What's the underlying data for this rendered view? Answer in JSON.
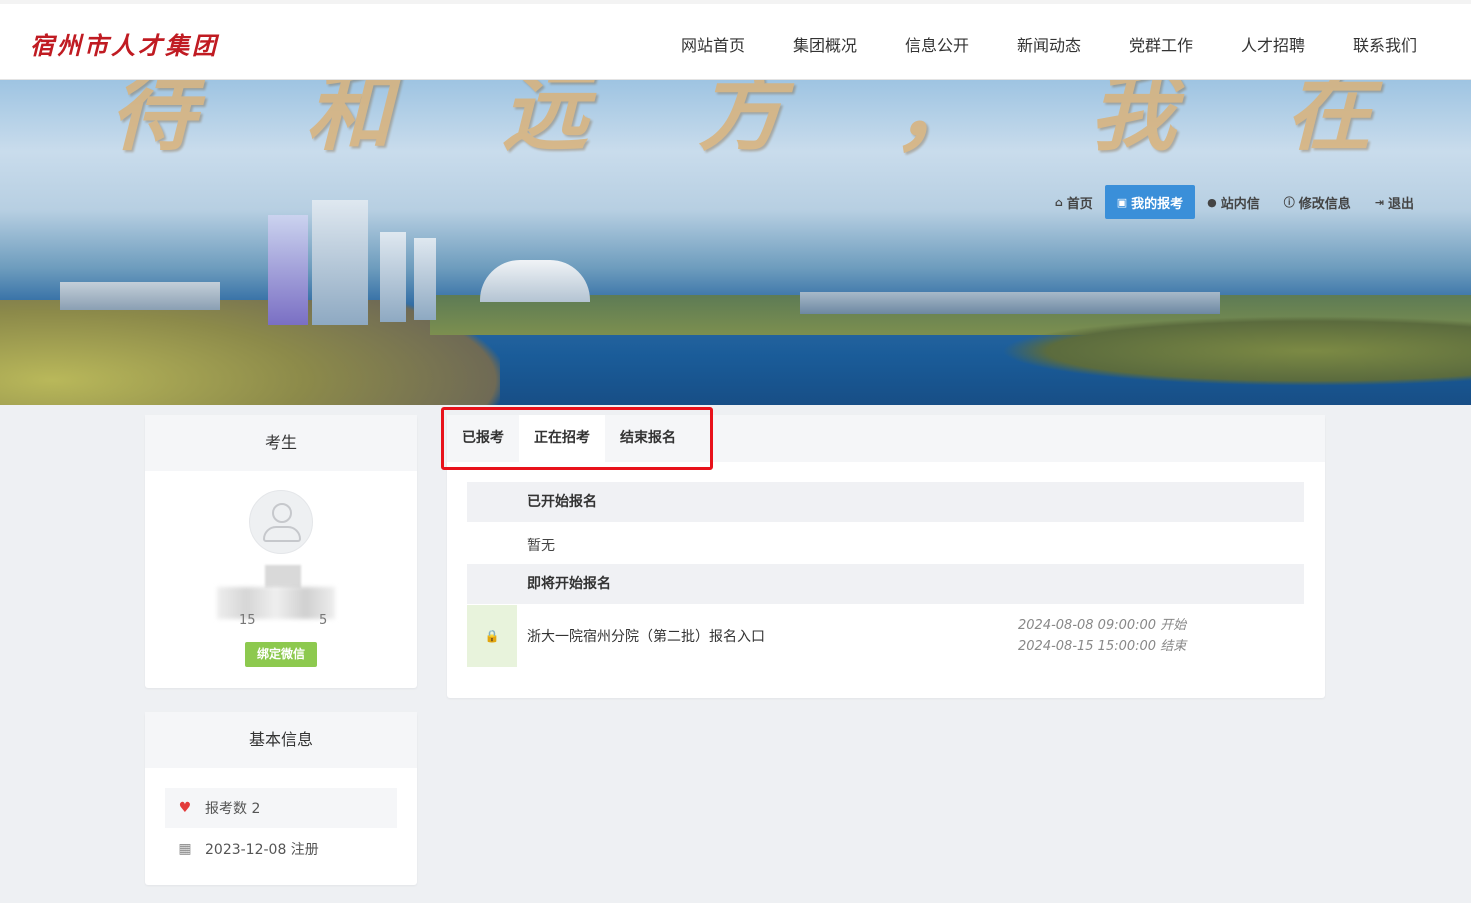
{
  "header": {
    "logo": "宿州市人才集团",
    "nav": [
      "网站首页",
      "集团概况",
      "信息公开",
      "新闻动态",
      "党群工作",
      "人才招聘",
      "联系我们"
    ]
  },
  "banner": {
    "slogan": "待 和 远 方 ， 我 在 宿 州 等 您"
  },
  "user_nav": [
    {
      "icon": "home-icon",
      "label": "首页"
    },
    {
      "icon": "id-card-icon",
      "label": "我的报考"
    },
    {
      "icon": "chat-icon",
      "label": "站内信"
    },
    {
      "icon": "info-icon",
      "label": "修改信息"
    },
    {
      "icon": "logout-icon",
      "label": "退出"
    }
  ],
  "profile": {
    "title": "考生",
    "phone_prefix": "15",
    "phone_suffix": "5",
    "bind_wechat": "绑定微信"
  },
  "basic_info": {
    "title": "基本信息",
    "exam_count": "报考数 2",
    "register_date": "2023-12-08 注册"
  },
  "tabs": [
    "已报考",
    "正在招考",
    "结束报名"
  ],
  "sections": {
    "started": {
      "title": "已开始报名",
      "empty": "暂无"
    },
    "upcoming": {
      "title": "即将开始报名",
      "items": [
        {
          "title": "浙大一院宿州分院（第二批）报名入口",
          "start": "2024-08-08 09:00:00 开始",
          "end": "2024-08-15 15:00:00 结束"
        }
      ]
    }
  },
  "colors": {
    "accent": "#3a8fd9",
    "wechat_button": "#8dc94f",
    "highlight": "#e8121b",
    "logo": "#c01b22"
  }
}
